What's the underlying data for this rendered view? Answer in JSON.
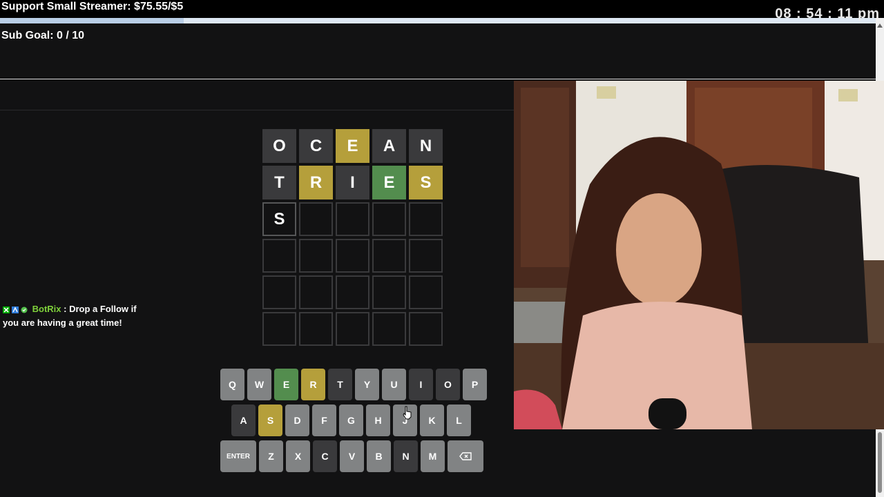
{
  "overlay": {
    "support_text": "Support Small Streamer: $75.55/$5",
    "support_progress": 0.21,
    "clock": "08 : 54 : 11 pm",
    "subgoal": "Sub Goal:  0 / 10"
  },
  "board": {
    "rows": [
      [
        {
          "l": "O",
          "s": "absent"
        },
        {
          "l": "C",
          "s": "absent"
        },
        {
          "l": "E",
          "s": "present"
        },
        {
          "l": "A",
          "s": "absent"
        },
        {
          "l": "N",
          "s": "absent"
        }
      ],
      [
        {
          "l": "T",
          "s": "absent"
        },
        {
          "l": "R",
          "s": "present"
        },
        {
          "l": "I",
          "s": "absent"
        },
        {
          "l": "E",
          "s": "correct"
        },
        {
          "l": "S",
          "s": "present"
        }
      ],
      [
        {
          "l": "S",
          "s": "typed"
        },
        {
          "l": "",
          "s": "empty"
        },
        {
          "l": "",
          "s": "empty"
        },
        {
          "l": "",
          "s": "empty"
        },
        {
          "l": "",
          "s": "empty"
        }
      ],
      [
        {
          "l": "",
          "s": "empty"
        },
        {
          "l": "",
          "s": "empty"
        },
        {
          "l": "",
          "s": "empty"
        },
        {
          "l": "",
          "s": "empty"
        },
        {
          "l": "",
          "s": "empty"
        }
      ],
      [
        {
          "l": "",
          "s": "empty"
        },
        {
          "l": "",
          "s": "empty"
        },
        {
          "l": "",
          "s": "empty"
        },
        {
          "l": "",
          "s": "empty"
        },
        {
          "l": "",
          "s": "empty"
        }
      ],
      [
        {
          "l": "",
          "s": "empty"
        },
        {
          "l": "",
          "s": "empty"
        },
        {
          "l": "",
          "s": "empty"
        },
        {
          "l": "",
          "s": "empty"
        },
        {
          "l": "",
          "s": "empty"
        }
      ]
    ]
  },
  "keyboard": {
    "rows": [
      [
        {
          "k": "Q",
          "s": ""
        },
        {
          "k": "W",
          "s": ""
        },
        {
          "k": "E",
          "s": "correct"
        },
        {
          "k": "R",
          "s": "present"
        },
        {
          "k": "T",
          "s": "absent"
        },
        {
          "k": "Y",
          "s": ""
        },
        {
          "k": "U",
          "s": ""
        },
        {
          "k": "I",
          "s": "absent"
        },
        {
          "k": "O",
          "s": "absent"
        },
        {
          "k": "P",
          "s": ""
        }
      ],
      [
        {
          "k": "A",
          "s": "absent"
        },
        {
          "k": "S",
          "s": "present"
        },
        {
          "k": "D",
          "s": ""
        },
        {
          "k": "F",
          "s": ""
        },
        {
          "k": "G",
          "s": ""
        },
        {
          "k": "H",
          "s": ""
        },
        {
          "k": "J",
          "s": ""
        },
        {
          "k": "K",
          "s": ""
        },
        {
          "k": "L",
          "s": ""
        }
      ],
      [
        {
          "k": "ENTER",
          "s": "wide"
        },
        {
          "k": "Z",
          "s": ""
        },
        {
          "k": "X",
          "s": ""
        },
        {
          "k": "C",
          "s": "absent"
        },
        {
          "k": "V",
          "s": ""
        },
        {
          "k": "B",
          "s": ""
        },
        {
          "k": "N",
          "s": "absent"
        },
        {
          "k": "M",
          "s": ""
        },
        {
          "k": "⌫",
          "s": "back"
        }
      ]
    ],
    "backspace_icon": "backspace-icon"
  },
  "chat": {
    "username": "BotRix",
    "separator": " : ",
    "message": "Drop a Follow if you are having a great time!",
    "badges": [
      "moderator-badge-icon",
      "verified-badge-icon",
      "sub-badge-icon"
    ],
    "name_color": "#7fd13b"
  },
  "colors": {
    "correct": "#538d4e",
    "present": "#b59f3b",
    "absent": "#3a3a3c",
    "key_default": "#818384",
    "background": "#121213"
  }
}
